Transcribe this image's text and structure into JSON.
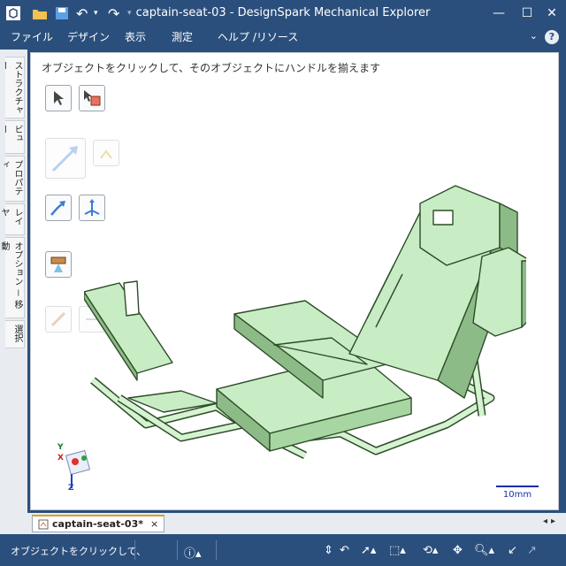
{
  "window": {
    "title": "captain-seat-03 - DesignSpark Mechanical Explorer"
  },
  "menu": {
    "items": [
      "ファイル",
      "デザイン",
      "表示",
      "測定",
      "ヘルプ /リソース"
    ],
    "help": "?"
  },
  "sidebar": {
    "tabs": [
      "ストラクチャー",
      "ビュー",
      "プロパティ",
      "レイヤ",
      "オプション － 移動",
      "選択"
    ]
  },
  "workspace": {
    "hint": "オブジェクトをクリックして、そのオブジェクトにハンドルを揃えます",
    "scale_label": "10mm",
    "axes": {
      "x": "X",
      "y": "Y",
      "z": "Z"
    }
  },
  "doc_tabs": [
    {
      "label": "captain-seat-03*",
      "close": "×"
    }
  ],
  "status": {
    "text": "オブジェクトをクリックして、"
  },
  "colors": {
    "chrome": "#2b4f7c",
    "model": "#c8ecc4",
    "model_edge": "#2e4d2a"
  }
}
